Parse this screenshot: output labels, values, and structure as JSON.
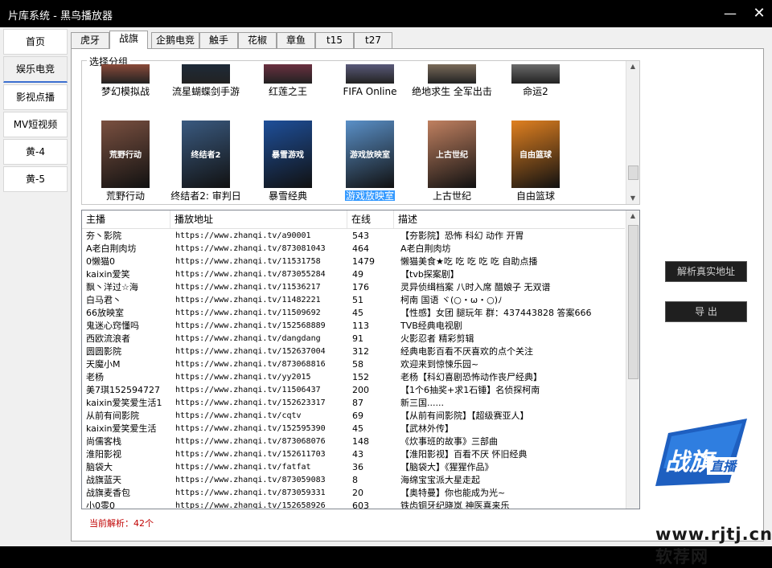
{
  "window": {
    "title": "片库系统 - 黑鸟播放器",
    "minimize_glyph": "—",
    "close_glyph": "✕"
  },
  "sidebar": {
    "items": [
      {
        "label": "首页"
      },
      {
        "label": "娱乐电竞",
        "active": true
      },
      {
        "label": "影视点播"
      },
      {
        "label": "MV短视频"
      },
      {
        "label": "黄-4"
      },
      {
        "label": "黄-5"
      }
    ]
  },
  "tabs": [
    {
      "label": "虎牙"
    },
    {
      "label": "战旗",
      "active": true
    },
    {
      "label": "企鹅电竞"
    },
    {
      "label": "触手"
    },
    {
      "label": "花椒"
    },
    {
      "label": "章鱼"
    },
    {
      "label": "t15"
    },
    {
      "label": "t27"
    }
  ],
  "group": {
    "legend": "选择分组",
    "items_row1": [
      {
        "label": "梦幻模拟战",
        "color": "#8a4a3a"
      },
      {
        "label": "流星蝴蝶剑手游",
        "color": "#1e2a38"
      },
      {
        "label": "红莲之王",
        "color": "#6a3040"
      },
      {
        "label": "FIFA Online",
        "color": "#5a5a7a"
      },
      {
        "label": "绝地求生 全军出击",
        "color": "#7a6a5a"
      },
      {
        "label": "命运2",
        "color": "#6a6a6a"
      }
    ],
    "items_row2": [
      {
        "label": "荒野行动",
        "color": "#7a5040",
        "art": "荒野行动"
      },
      {
        "label": "终结者2: 审判日",
        "color": "#3a5a80",
        "art": "终结者2"
      },
      {
        "label": "暴雪经典",
        "color": "#1e4f9a",
        "art": "暴雪游戏"
      },
      {
        "label": "游戏放映室",
        "color": "#5a90c8",
        "art": "游戏放映室",
        "selected": true
      },
      {
        "label": "上古世纪",
        "color": "#c08060",
        "art": "上古世纪"
      },
      {
        "label": "自由篮球",
        "color": "#e08020",
        "art": "自由篮球"
      }
    ]
  },
  "table": {
    "headers": [
      "主播",
      "播放地址",
      "在线",
      "描述"
    ],
    "rows": [
      [
        "夯丶影院",
        "https://www.zhanqi.tv/a90001",
        "543",
        "【夯影院】恐怖 科幻 动作 开胃"
      ],
      [
        "A老白荆肉坊",
        "https://www.zhanqi.tv/873081043",
        "464",
        "A老白荆肉坊"
      ],
      [
        "0懒猫0",
        "https://www.zhanqi.tv/11531758",
        "1479",
        "懒猫美食★吃 吃 吃 吃 吃 自助点播"
      ],
      [
        "kaixin爱笑",
        "https://www.zhanqi.tv/873055284",
        "49",
        "【tvb探案剧】"
      ],
      [
        "飘丶洋过☆海",
        "https://www.zhanqi.tv/11536217",
        "176",
        "灵异侦缉档案 八时入席 醋娘子 无双谱"
      ],
      [
        "白马君丶",
        "https://www.zhanqi.tv/11482221",
        "51",
        "柯南 国语 ヾ(○・ω・○)ﾉ"
      ],
      [
        "66放映室",
        "https://www.zhanqi.tv/11509692",
        "45",
        "【性感】女团 腿玩年  群：437443828 答案666"
      ],
      [
        "鬼迷心窍懂吗",
        "https://www.zhanqi.tv/152568889",
        "113",
        "TVB经典电视剧"
      ],
      [
        "西欧流浪者",
        "https://www.zhanqi.tv/dangdang",
        "91",
        "火影忍者 精彩剪辑"
      ],
      [
        "圆圆影院",
        "https://www.zhanqi.tv/152637004",
        "312",
        "经典电影百看不厌喜欢的点个关注"
      ],
      [
        "天魔小M",
        "https://www.zhanqi.tv/873068816",
        "58",
        "欢迎来到惊悚乐园~"
      ],
      [
        "老杨",
        "https://www.zhanqi.tv/yy2015",
        "152",
        "老杨【科幻喜剧恐怖动作丧尸经典】"
      ],
      [
        "美7琪152594727",
        "https://www.zhanqi.tv/11506437",
        "200",
        "【1个6抽奖+求1石锤】名侦探柯南"
      ],
      [
        "kaixin爱笑爱生活1",
        "https://www.zhanqi.tv/152623317",
        "87",
        "新三国......"
      ],
      [
        "从前有间影院",
        "https://www.zhanqi.tv/cqtv",
        "69",
        "【从前有间影院】【超级赛亚人】"
      ],
      [
        "kaixin爱笑爱生活",
        "https://www.zhanqi.tv/152595390",
        "45",
        "【武林外传】"
      ],
      [
        "尚儒客栈",
        "https://www.zhanqi.tv/873068076",
        "148",
        "《炊事班的故事》三部曲"
      ],
      [
        "淮阳影视",
        "https://www.zhanqi.tv/152611703",
        "43",
        "【淮阳影视】百看不厌   怀旧经典"
      ],
      [
        "脑袋大",
        "https://www.zhanqi.tv/fatfat",
        "36",
        "【脑袋大】《猩猩作品》"
      ],
      [
        "战旗蓝天",
        "https://www.zhanqi.tv/873059083",
        "8",
        "海绵宝宝派大星走起"
      ],
      [
        "战旗麦香包",
        "https://www.zhanqi.tv/873059331",
        "20",
        "【奥特曼】你也能成为光~"
      ],
      [
        "小0零0",
        "https://www.zhanqi.tv/152658926",
        "603",
        "铁齿铜牙纪晓岚 神医喜来乐"
      ]
    ]
  },
  "status_text": "当前解析：42个",
  "buttons": {
    "parse_label": "解析真实地址",
    "export_label": "导 出"
  },
  "logo": {
    "main": "战旗",
    "sub": "直播"
  },
  "watermark": "www.rjtj.cn软荐网",
  "colors": {
    "accent": "#3c6fd0",
    "status": "#c00000",
    "logo_blue": "#1e5fc0"
  }
}
